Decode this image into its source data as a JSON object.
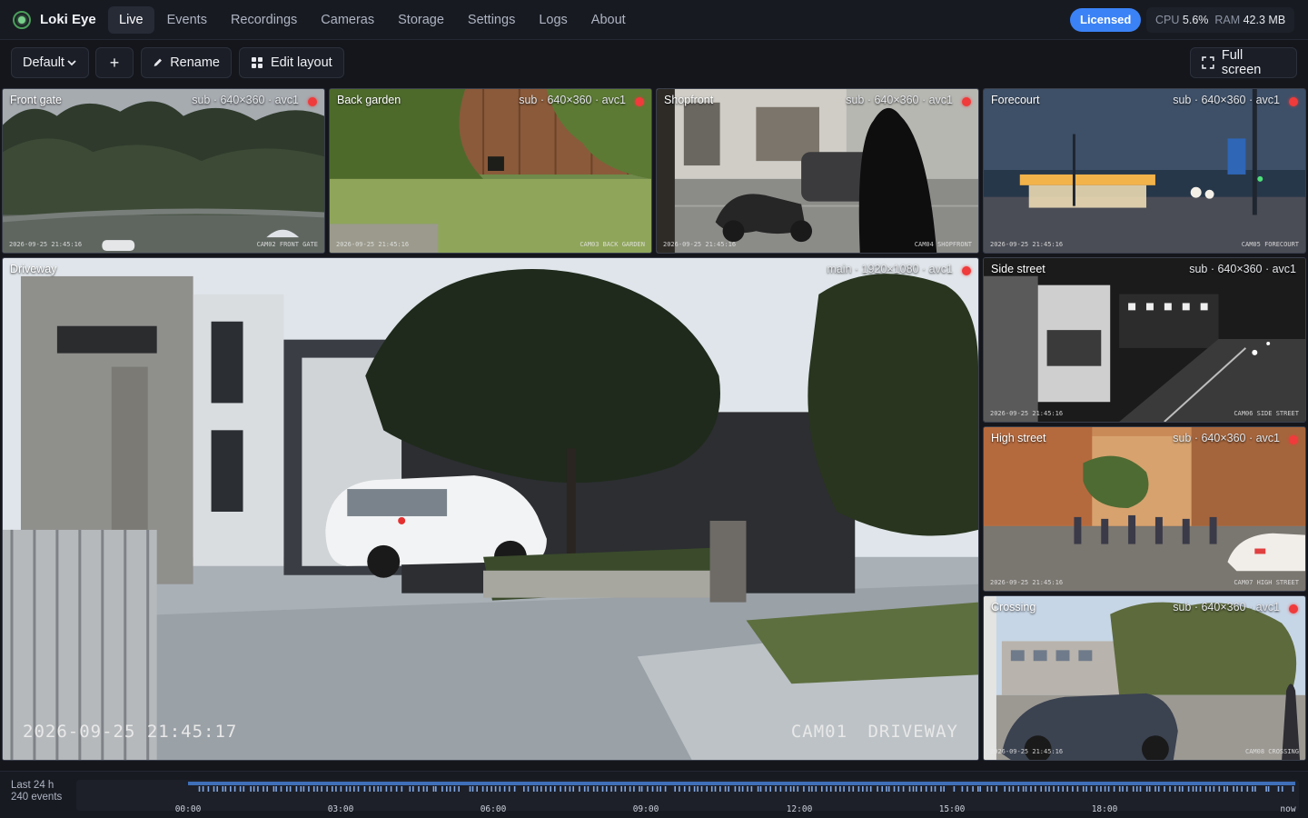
{
  "app": {
    "name": "Loki Eye"
  },
  "nav": {
    "items": [
      "Live",
      "Events",
      "Recordings",
      "Cameras",
      "Storage",
      "Settings",
      "Logs",
      "About"
    ],
    "active": "Live"
  },
  "status": {
    "license": "Licensed",
    "cpu_label": "CPU",
    "cpu_value": "5.6%",
    "ram_label": "RAM",
    "ram_value": "42.3 MB"
  },
  "toolbar": {
    "layout_select": "Default",
    "add_label": "+",
    "rename_label": "Rename",
    "edit_layout_label": "Edit layout",
    "fullscreen_label": "Full screen"
  },
  "cameras": [
    {
      "label": "Front gate",
      "meta": "sub · 640×360 · avc1",
      "timestamp": "2026-09-25 21:45:16",
      "overlay": "CAM02  FRONT GATE",
      "recording": true
    },
    {
      "label": "Back garden",
      "meta": "sub · 640×360 · avc1",
      "timestamp": "2026-09-25 21:45:16",
      "overlay": "CAM03  BACK GARDEN",
      "recording": true
    },
    {
      "label": "Shopfront",
      "meta": "sub · 640×360 · avc1",
      "timestamp": "2026-09-25 21:45:16",
      "overlay": "CAM04  SHOPFRONT",
      "recording": true
    },
    {
      "label": "Forecourt",
      "meta": "sub · 640×360 · avc1",
      "timestamp": "2026-09-25 21:45:16",
      "overlay": "CAM05  FORECOURT",
      "recording": true
    },
    {
      "label": "Driveway",
      "meta": "main · 1920×1080 · avc1",
      "timestamp": "2026-09-25 21:45:17",
      "overlay": "CAM01  DRIVEWAY",
      "recording": true
    },
    {
      "label": "Side street",
      "meta": "sub · 640×360 · avc1",
      "timestamp": "2026-09-25 21:45:16",
      "overlay": "CAM06  SIDE STREET",
      "recording": false
    },
    {
      "label": "High street",
      "meta": "sub · 640×360 · avc1",
      "timestamp": "2026-09-25 21:45:16",
      "overlay": "CAM07  HIGH STREET",
      "recording": true
    },
    {
      "label": "Crossing",
      "meta": "sub · 640×360 · avc1",
      "timestamp": "2026-09-25 21:45:16",
      "overlay": "CAM08  CROSSING",
      "recording": true
    }
  ],
  "timeline": {
    "range_label": "Last 24 h",
    "events_label": "240 events",
    "ticks": [
      "00:00",
      "03:00",
      "06:00",
      "09:00",
      "12:00",
      "15:00",
      "18:00",
      "now"
    ]
  },
  "colors": {
    "accent": "#3b82f6",
    "recording": "#ef3b3b",
    "timeline_bar": "#3f6fb8",
    "background": "#14161c"
  }
}
